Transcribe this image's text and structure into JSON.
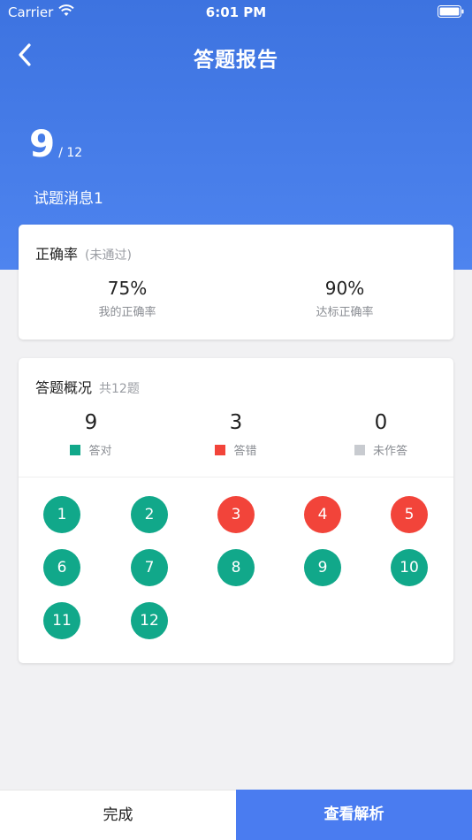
{
  "status": {
    "carrier": "Carrier",
    "time": "6:01 PM"
  },
  "nav": {
    "title": "答题报告"
  },
  "score": {
    "correct": "9",
    "total": "/ 12"
  },
  "quiz_name": "试题消息1",
  "accuracy": {
    "title": "正确率",
    "status": "(未通过)",
    "mine_value": "75%",
    "mine_label": "我的正确率",
    "target_value": "90%",
    "target_label": "达标正确率"
  },
  "overview": {
    "title": "答题概况",
    "count": "共12题",
    "correct_value": "9",
    "correct_label": "答对",
    "wrong_value": "3",
    "wrong_label": "答错",
    "blank_value": "0",
    "blank_label": "未作答",
    "questions": [
      {
        "num": "1",
        "status": "correct"
      },
      {
        "num": "2",
        "status": "correct"
      },
      {
        "num": "3",
        "status": "wrong"
      },
      {
        "num": "4",
        "status": "wrong"
      },
      {
        "num": "5",
        "status": "wrong"
      },
      {
        "num": "6",
        "status": "correct"
      },
      {
        "num": "7",
        "status": "correct"
      },
      {
        "num": "8",
        "status": "correct"
      },
      {
        "num": "9",
        "status": "correct"
      },
      {
        "num": "10",
        "status": "correct"
      },
      {
        "num": "11",
        "status": "correct"
      },
      {
        "num": "12",
        "status": "correct"
      }
    ]
  },
  "colors": {
    "correct": "#11a88a",
    "wrong": "#f2443a",
    "blank": "#c8cbd0",
    "accent": "#4a7cf0"
  },
  "footer": {
    "done_label": "完成",
    "analysis_label": "查看解析"
  }
}
